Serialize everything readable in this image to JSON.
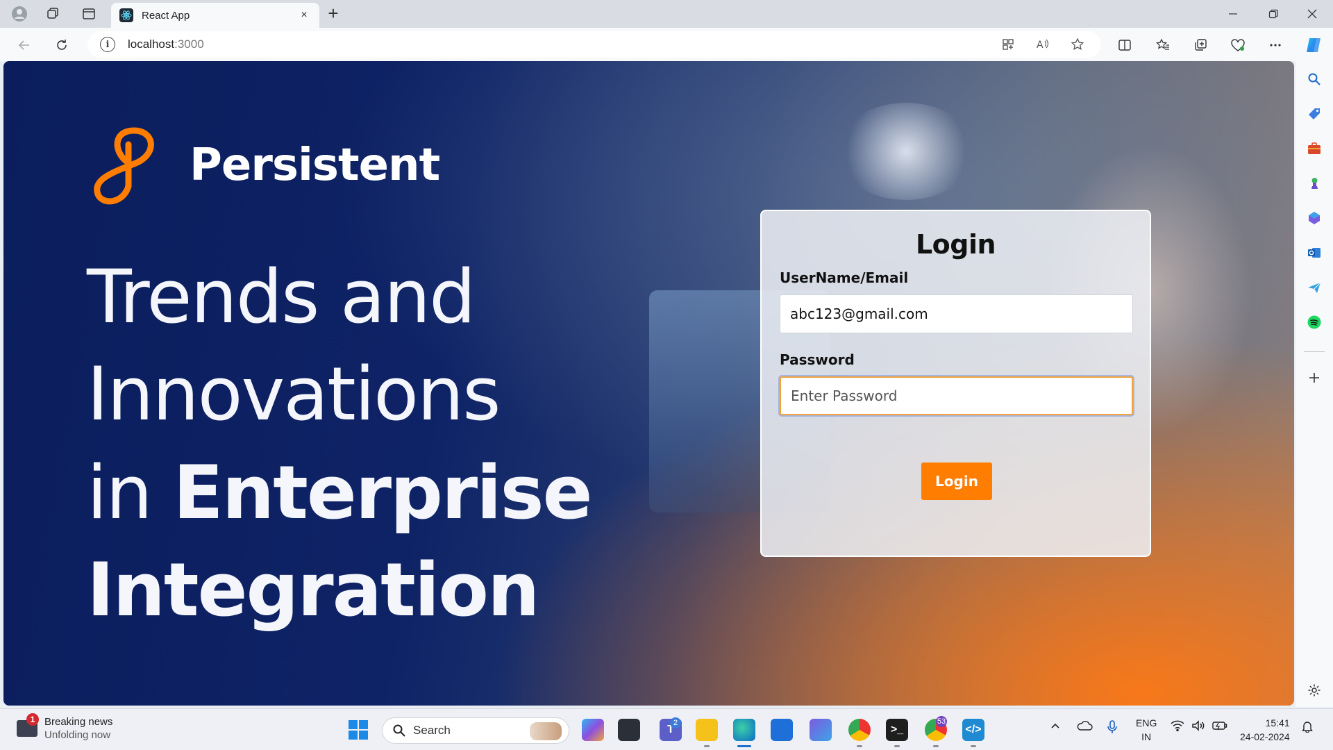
{
  "browser": {
    "tab_title": "React App",
    "url_host": "localhost",
    "url_port": ":3000",
    "new_tab_symbol": "+",
    "close_tab_symbol": "×"
  },
  "page": {
    "brand_name": "Persistent",
    "hero_line1": "Trends and",
    "hero_line2": "Innovations",
    "hero_line3_prefix": "in ",
    "hero_line3_bold": "Enterprise",
    "hero_line4": "Integration",
    "colors": {
      "accent": "#ff7d00",
      "navy": "#0b1d5c"
    }
  },
  "login": {
    "title": "Login",
    "username_label": "UserName/Email",
    "username_value": "abc123@gmail.com",
    "password_label": "Password",
    "password_placeholder": "Enter Password",
    "submit_label": "Login"
  },
  "taskbar": {
    "news_badge": "1",
    "news_title": "Breaking news",
    "news_subtitle": "Unfolding now",
    "search_label": "Search",
    "teams_badge": "2",
    "chrome_badge": "53",
    "lang_primary": "ENG",
    "lang_region": "IN",
    "time": "15:41",
    "date": "24-02-2024"
  }
}
